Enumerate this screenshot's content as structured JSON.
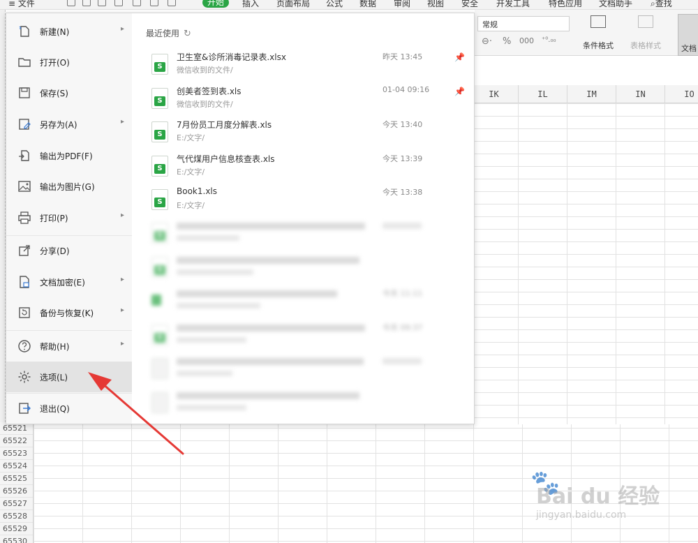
{
  "toolbar": {
    "file_label": "≡ 文件",
    "tabs": [
      "开始",
      "插入",
      "页面布局",
      "公式",
      "数据",
      "审阅",
      "视图",
      "安全",
      "开发工具",
      "特色应用",
      "文档助手"
    ],
    "active_tab": "开始",
    "search_label": "查找"
  },
  "ribbon": {
    "number_format": "常规",
    "percent_symbol": "%",
    "conditional_format": "条件格式",
    "table_style": "表格样式",
    "doc_label": "文档"
  },
  "columns": [
    "IK",
    "IL",
    "IM",
    "IN",
    "IO"
  ],
  "row_numbers": [
    "65521",
    "65522",
    "65523",
    "65524",
    "65525",
    "65526",
    "65527",
    "65528",
    "65529",
    "65530"
  ],
  "menu": {
    "items": [
      {
        "label": "新建(N)",
        "icon": "new-file-icon",
        "has_submenu": true
      },
      {
        "label": "打开(O)",
        "icon": "folder-icon",
        "has_submenu": false
      },
      {
        "label": "保存(S)",
        "icon": "save-icon",
        "has_submenu": false
      },
      {
        "label": "另存为(A)",
        "icon": "save-as-icon",
        "has_submenu": true
      },
      {
        "label": "输出为PDF(F)",
        "icon": "pdf-export-icon",
        "has_submenu": false
      },
      {
        "label": "输出为图片(G)",
        "icon": "image-export-icon",
        "has_submenu": false
      },
      {
        "label": "打印(P)",
        "icon": "printer-icon",
        "has_submenu": true
      },
      {
        "label": "分享(D)",
        "icon": "share-icon",
        "has_submenu": false
      },
      {
        "label": "文档加密(E)",
        "icon": "encrypt-icon",
        "has_submenu": true
      },
      {
        "label": "备份与恢复(K)",
        "icon": "backup-icon",
        "has_submenu": true
      },
      {
        "label": "帮助(H)",
        "icon": "help-icon",
        "has_submenu": true
      },
      {
        "label": "选项(L)",
        "icon": "gear-icon",
        "has_submenu": false
      },
      {
        "label": "退出(Q)",
        "icon": "exit-icon",
        "has_submenu": false
      }
    ],
    "selected": "选项(L)",
    "submenu_arrow": "▸"
  },
  "recent": {
    "title": "最近使用",
    "refresh_symbol": "↻",
    "file_badge": "S",
    "pin_symbol": "📌",
    "close_symbol": "✕",
    "files": [
      {
        "name": "卫生室&诊所消毒记录表.xlsx",
        "path": "微信收到的文件/",
        "time": "昨天 13:45",
        "pinned": true
      },
      {
        "name": "创美者签到表.xls",
        "path": "微信收到的文件/",
        "time": "01-04 09:16",
        "pinned": true
      },
      {
        "name": "7月份员工月度分解表.xls",
        "path": "E:/文字/",
        "time": "今天 13:40",
        "pinned": false
      },
      {
        "name": "气代煤用户信息核查表.xls",
        "path": "E:/文字/",
        "time": "今天 13:39",
        "pinned": false
      },
      {
        "name": "Book1.xls",
        "path": "E:/文字/",
        "time": "今天 13:38",
        "pinned": false
      }
    ],
    "blurred_times": [
      "今天 11:11",
      "今天 09:37"
    ]
  },
  "watermark": {
    "brand": "Bai du 经验",
    "url": "jingyan.baidu.com"
  },
  "colors": {
    "accent_green": "#2aa545",
    "arrow_red": "#e53935",
    "selected_bg": "#e3e3e3"
  }
}
